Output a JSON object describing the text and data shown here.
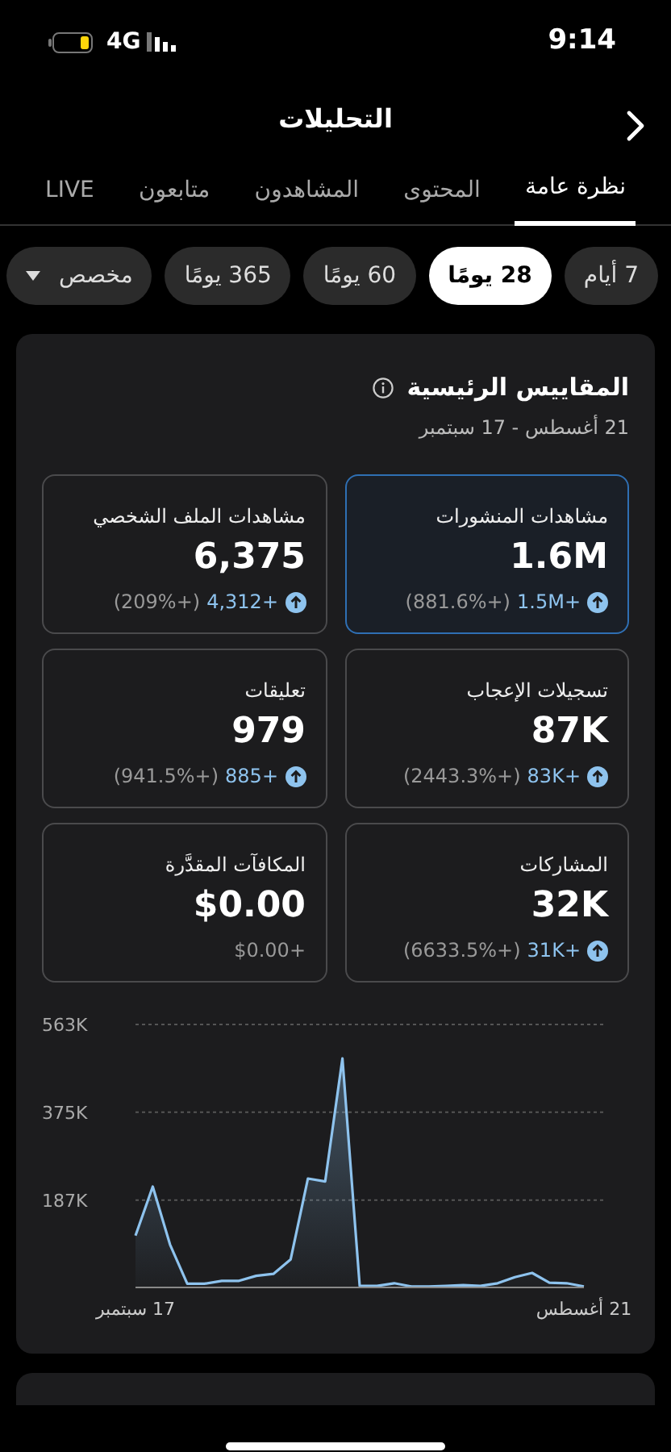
{
  "status_bar": {
    "time": "9:14",
    "network": "4G"
  },
  "header": {
    "title": "التحليلات"
  },
  "tabs": [
    {
      "label": "نظرة عامة",
      "selected": true
    },
    {
      "label": "المحتوى",
      "selected": false
    },
    {
      "label": "المشاهدون",
      "selected": false
    },
    {
      "label": "متابعون",
      "selected": false
    },
    {
      "label": "LIVE",
      "selected": false
    }
  ],
  "periods": [
    {
      "label": "7 أيام",
      "selected": false,
      "kind": "pill"
    },
    {
      "label": "28 يومًا",
      "selected": true,
      "kind": "pill"
    },
    {
      "label": "60 يومًا",
      "selected": false,
      "kind": "pill"
    },
    {
      "label": "365 يومًا",
      "selected": false,
      "kind": "pill"
    },
    {
      "label": "مخصص",
      "selected": false,
      "kind": "dropdown"
    }
  ],
  "key_metrics": {
    "title": "المقاييس الرئيسية",
    "date_range": "21 أغسطس - 17 سبتمبر",
    "metrics": [
      {
        "label": "مشاهدات المنشورات",
        "value": "1.6M",
        "change": "+1.5M",
        "percent": "(+881.6%)",
        "kind": "up",
        "selected": true
      },
      {
        "label": "مشاهدات الملف الشخصي",
        "value": "6,375",
        "change": "+4,312",
        "percent": "(+209%)",
        "kind": "up",
        "selected": false
      },
      {
        "label": "تسجيلات الإعجاب",
        "value": "87K",
        "change": "+83K",
        "percent": "(+2443.3%)",
        "kind": "up",
        "selected": false
      },
      {
        "label": "تعليقات",
        "value": "979",
        "change": "+885",
        "percent": "(+941.5%)",
        "kind": "up",
        "selected": false
      },
      {
        "label": "المشاركات",
        "value": "32K",
        "change": "+31K",
        "percent": "(+6633.5%)",
        "kind": "up",
        "selected": false
      },
      {
        "label": "المكافآت المقدَّرة",
        "value": "$0.00",
        "change": "+$0.00",
        "kind": "flat",
        "selected": false
      }
    ],
    "chart_data": {
      "type": "area",
      "ylim": [
        0,
        563
      ],
      "categories": [
        "17 سبتمبر",
        null,
        null,
        null,
        null,
        null,
        null,
        null,
        null,
        null,
        null,
        null,
        null,
        null,
        null,
        null,
        null,
        null,
        null,
        null,
        null,
        null,
        null,
        null,
        null,
        null,
        "21 أغسطس"
      ],
      "yticks": [
        {
          "value": 187,
          "label": "187K"
        },
        {
          "value": 375,
          "label": "375K"
        },
        {
          "value": 563,
          "label": "563K"
        }
      ],
      "series": [
        {
          "color": "#8ec3ee",
          "values": [
            111,
            216,
            92,
            8,
            8,
            14,
            14,
            25,
            29,
            60,
            233,
            227,
            490,
            3,
            3,
            9,
            2,
            2,
            3,
            5,
            3,
            9,
            22,
            31,
            10,
            9,
            2
          ]
        }
      ]
    }
  }
}
